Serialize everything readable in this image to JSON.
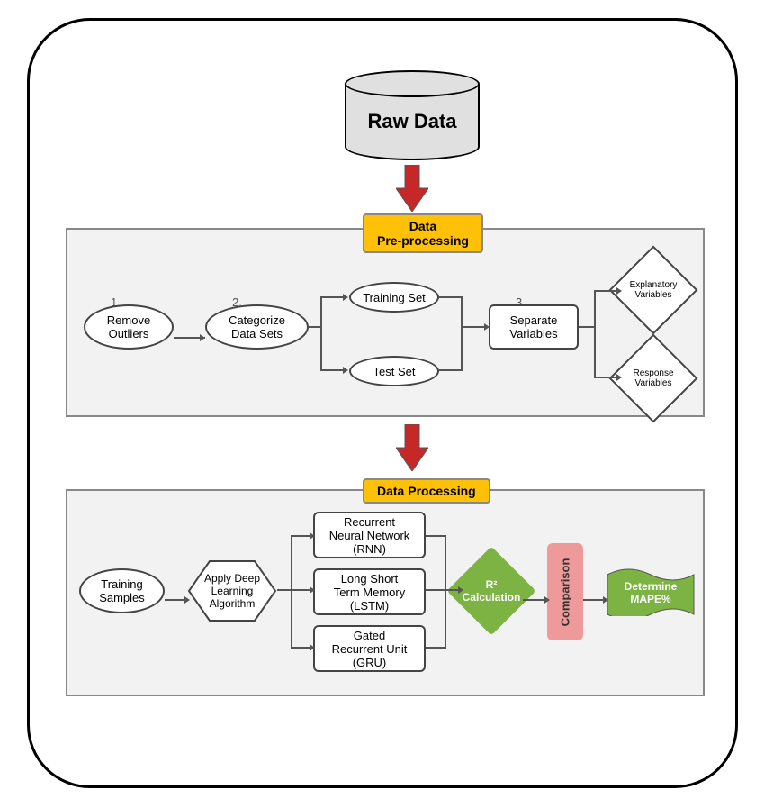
{
  "title": "Raw Data",
  "sections": {
    "preprocessing": {
      "label": "Data\nPre-processing",
      "steps": {
        "s1": {
          "num": "1.",
          "label": "Remove\nOutliers"
        },
        "s2": {
          "num": "2.",
          "label": "Categorize\nData Sets"
        },
        "training_set": "Training Set",
        "test_set": "Test Set",
        "s3": {
          "num": "3.",
          "label": "Separate\nVariables"
        },
        "explanatory": "Explanatory\nVariables",
        "response": "Response\nVariables"
      }
    },
    "processing": {
      "label": "Data Processing",
      "training_samples": "Training\nSamples",
      "apply_algo": "Apply Deep\nLearning\nAlgorithm",
      "rnn": "Recurrent\nNeural Network\n(RNN)",
      "lstm": "Long Short\nTerm Memory\n(LSTM)",
      "gru": "Gated\nRecurrent Unit\n(GRU)",
      "r2": "R²\nCalculation",
      "comparison": "Comparison",
      "determine": "Determine\nMAPE%"
    }
  }
}
